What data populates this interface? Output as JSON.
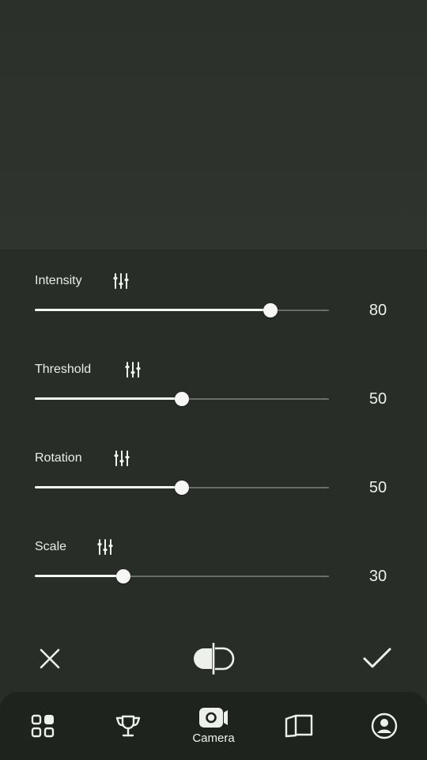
{
  "sliders": [
    {
      "label": "Intensity",
      "value": "80",
      "level": 80
    },
    {
      "label": "Threshold",
      "value": "50",
      "level": 50
    },
    {
      "label": "Rotation",
      "value": "50",
      "level": 50
    },
    {
      "label": "Scale",
      "value": "30",
      "level": 30
    }
  ],
  "actions": {
    "cancel_icon": "close-icon",
    "compare_icon": "compare-icon",
    "confirm_icon": "check-icon"
  },
  "nav": {
    "items": [
      {
        "icon": "grid-icon",
        "label": ""
      },
      {
        "icon": "trophy-icon",
        "label": ""
      },
      {
        "icon": "camera-icon",
        "label": "Camera"
      },
      {
        "icon": "book-icon",
        "label": ""
      },
      {
        "icon": "profile-icon",
        "label": ""
      }
    ]
  },
  "colors": {
    "background": "#2a2e28",
    "panel": "#292d27",
    "nav": "#1f231d",
    "accent": "#f4f6f2",
    "track": "#6b6f69"
  }
}
